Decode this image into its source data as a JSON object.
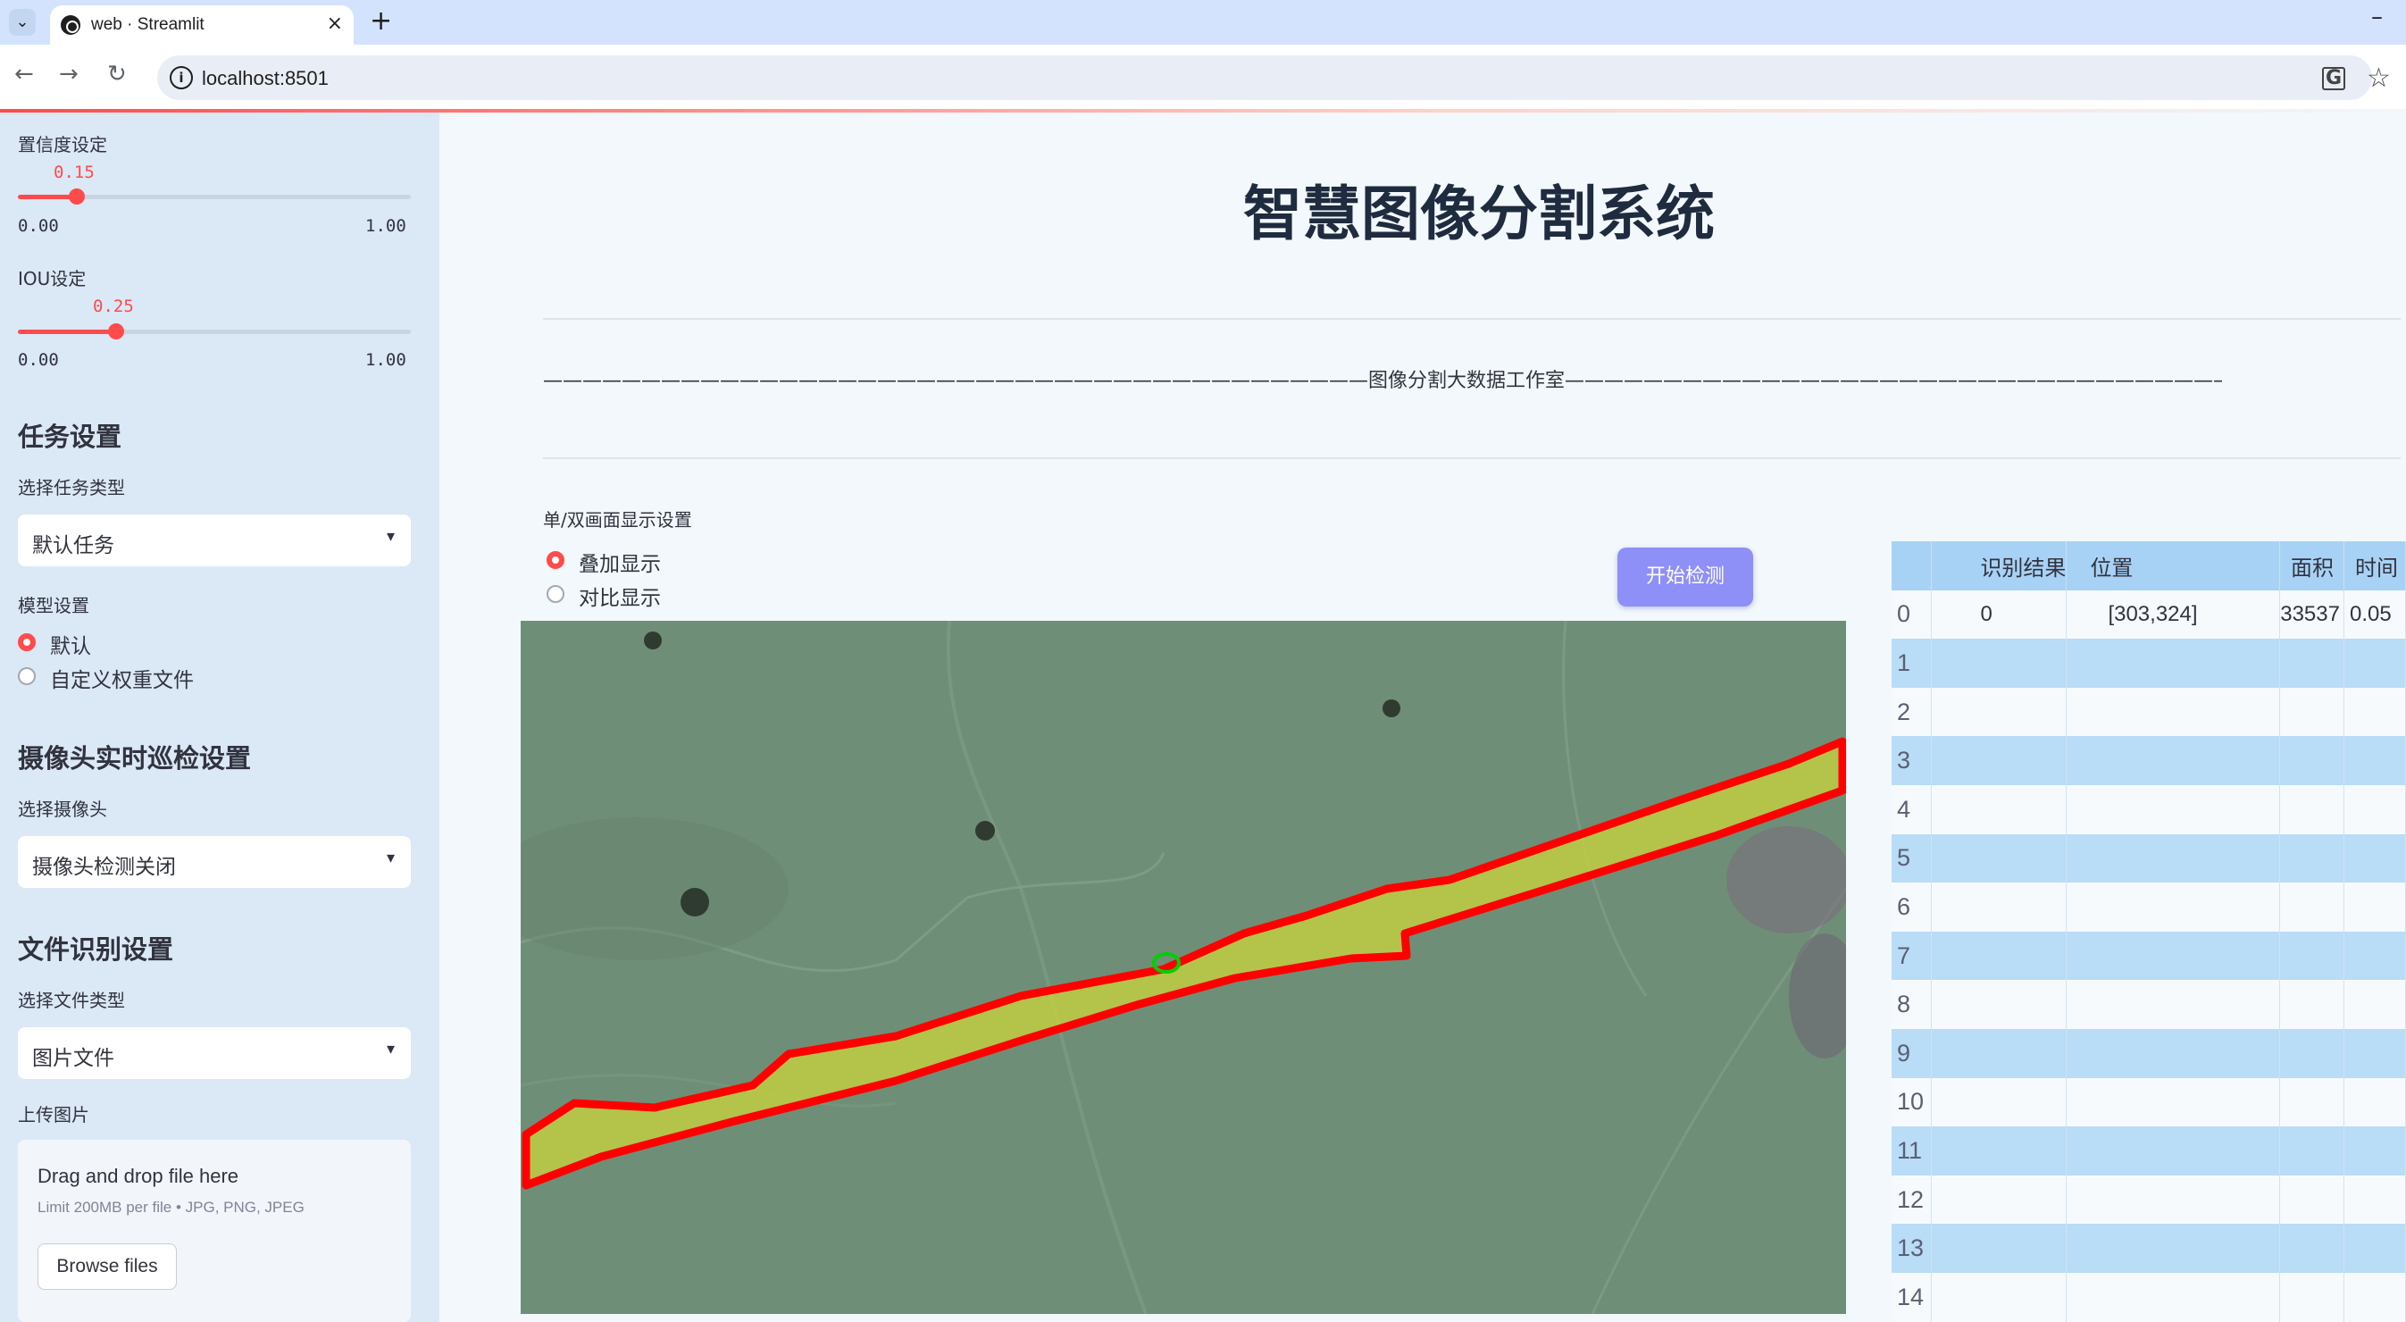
{
  "browser": {
    "tab_title": "web · Streamlit",
    "tab_close": "×",
    "new_tab": "+",
    "minimize": "–",
    "url": "localhost:8501",
    "back": "←",
    "forward": "→",
    "reload": "↻",
    "info": "i",
    "translate": "G",
    "bookmark": "☆",
    "tab_list": "⌄"
  },
  "sidebar": {
    "conf_label": "置信度设定",
    "conf": {
      "value": 0.15,
      "value_text": "0.15",
      "min": "0.00",
      "max": "1.00"
    },
    "iou_label": "IOU设定",
    "iou": {
      "value": 0.25,
      "value_text": "0.25",
      "min": "0.00",
      "max": "1.00"
    },
    "task_header": "任务设置",
    "task_type_label": "选择任务类型",
    "task_type_value": "默认任务",
    "model_label": "模型设置",
    "model_options": [
      "默认",
      "自定义权重文件"
    ],
    "model_selected": 0,
    "camera_header": "摄像头实时巡检设置",
    "camera_label": "选择摄像头",
    "camera_value": "摄像头检测关闭",
    "file_header": "文件识别设置",
    "file_type_label": "选择文件类型",
    "file_type_value": "图片文件",
    "upload_label": "上传图片",
    "upload_title": "Drag and drop file here",
    "upload_limit": "Limit 200MB per file • JPG, PNG, JPEG",
    "upload_button": "Browse files",
    "caret": "▾"
  },
  "main": {
    "title": "智慧图像分割系统",
    "studio_line": "——————————————————————————————————————————图像分割大数据工作室—————————————————————————————————————————",
    "display_label": "单/双画面显示设置",
    "display_options": [
      "叠加显示",
      "对比显示"
    ],
    "display_selected": 0,
    "start_button": "开始检测"
  },
  "results_table": {
    "columns": [
      "",
      "识别结果",
      "位置",
      "面积",
      "时间"
    ],
    "rows": [
      {
        "index": "0",
        "result": "0",
        "position": "[303,324]",
        "area": "33537",
        "time": "0.05"
      },
      {
        "index": "1",
        "result": "",
        "position": "",
        "area": "",
        "time": ""
      },
      {
        "index": "2",
        "result": "",
        "position": "",
        "area": "",
        "time": ""
      },
      {
        "index": "3",
        "result": "",
        "position": "",
        "area": "",
        "time": ""
      },
      {
        "index": "4",
        "result": "",
        "position": "",
        "area": "",
        "time": ""
      },
      {
        "index": "5",
        "result": "",
        "position": "",
        "area": "",
        "time": ""
      },
      {
        "index": "6",
        "result": "",
        "position": "",
        "area": "",
        "time": ""
      },
      {
        "index": "7",
        "result": "",
        "position": "",
        "area": "",
        "time": ""
      },
      {
        "index": "8",
        "result": "",
        "position": "",
        "area": "",
        "time": ""
      },
      {
        "index": "9",
        "result": "",
        "position": "",
        "area": "",
        "time": ""
      },
      {
        "index": "10",
        "result": "",
        "position": "",
        "area": "",
        "time": ""
      },
      {
        "index": "11",
        "result": "",
        "position": "",
        "area": "",
        "time": ""
      },
      {
        "index": "12",
        "result": "",
        "position": "",
        "area": "",
        "time": ""
      },
      {
        "index": "13",
        "result": "",
        "position": "",
        "area": "",
        "time": ""
      },
      {
        "index": "14",
        "result": "",
        "position": "",
        "area": "",
        "time": ""
      }
    ]
  },
  "colors": {
    "accent": "#ff4b4b",
    "start_button": "#8f8ff8",
    "segmentation_outline": "#ff0000",
    "segmentation_fill": "#c8d23c",
    "small_detection": "#00d000"
  }
}
